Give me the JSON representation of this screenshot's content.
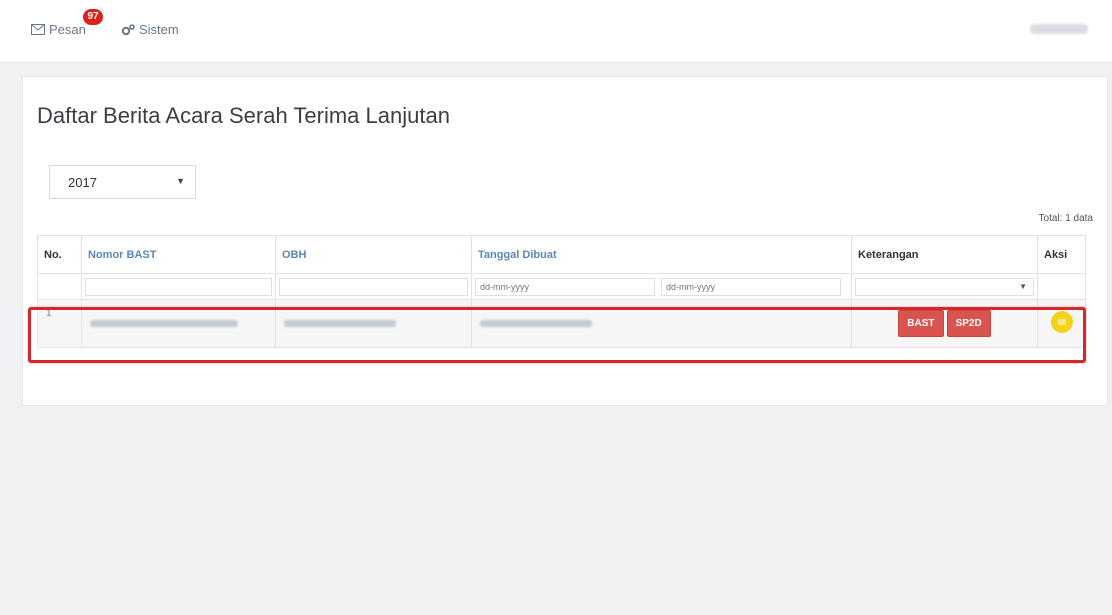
{
  "nav": {
    "pesan_label": "Pesan",
    "pesan_badge": "97",
    "sistem_label": "Sistem"
  },
  "page": {
    "title": "Daftar Berita Acara Serah Terima Lanjutan",
    "year_selected": "2017",
    "total_label": "Total: 1 data"
  },
  "table": {
    "headers": [
      "No.",
      "Nomor BAST",
      "OBH",
      "Tanggal Dibuat",
      "Keterangan",
      "Aksi"
    ],
    "date_placeholder": "dd-mm-yyyy",
    "rows": [
      {
        "no": "1",
        "btn_bast": "BAST",
        "btn_sp2d": "SP2D"
      }
    ]
  },
  "colors": {
    "badge": "#d9221c",
    "link_header": "#5b87b6",
    "danger_button": "#d9534f",
    "action_button": "#f3d21b",
    "highlight": "#d6262e"
  }
}
